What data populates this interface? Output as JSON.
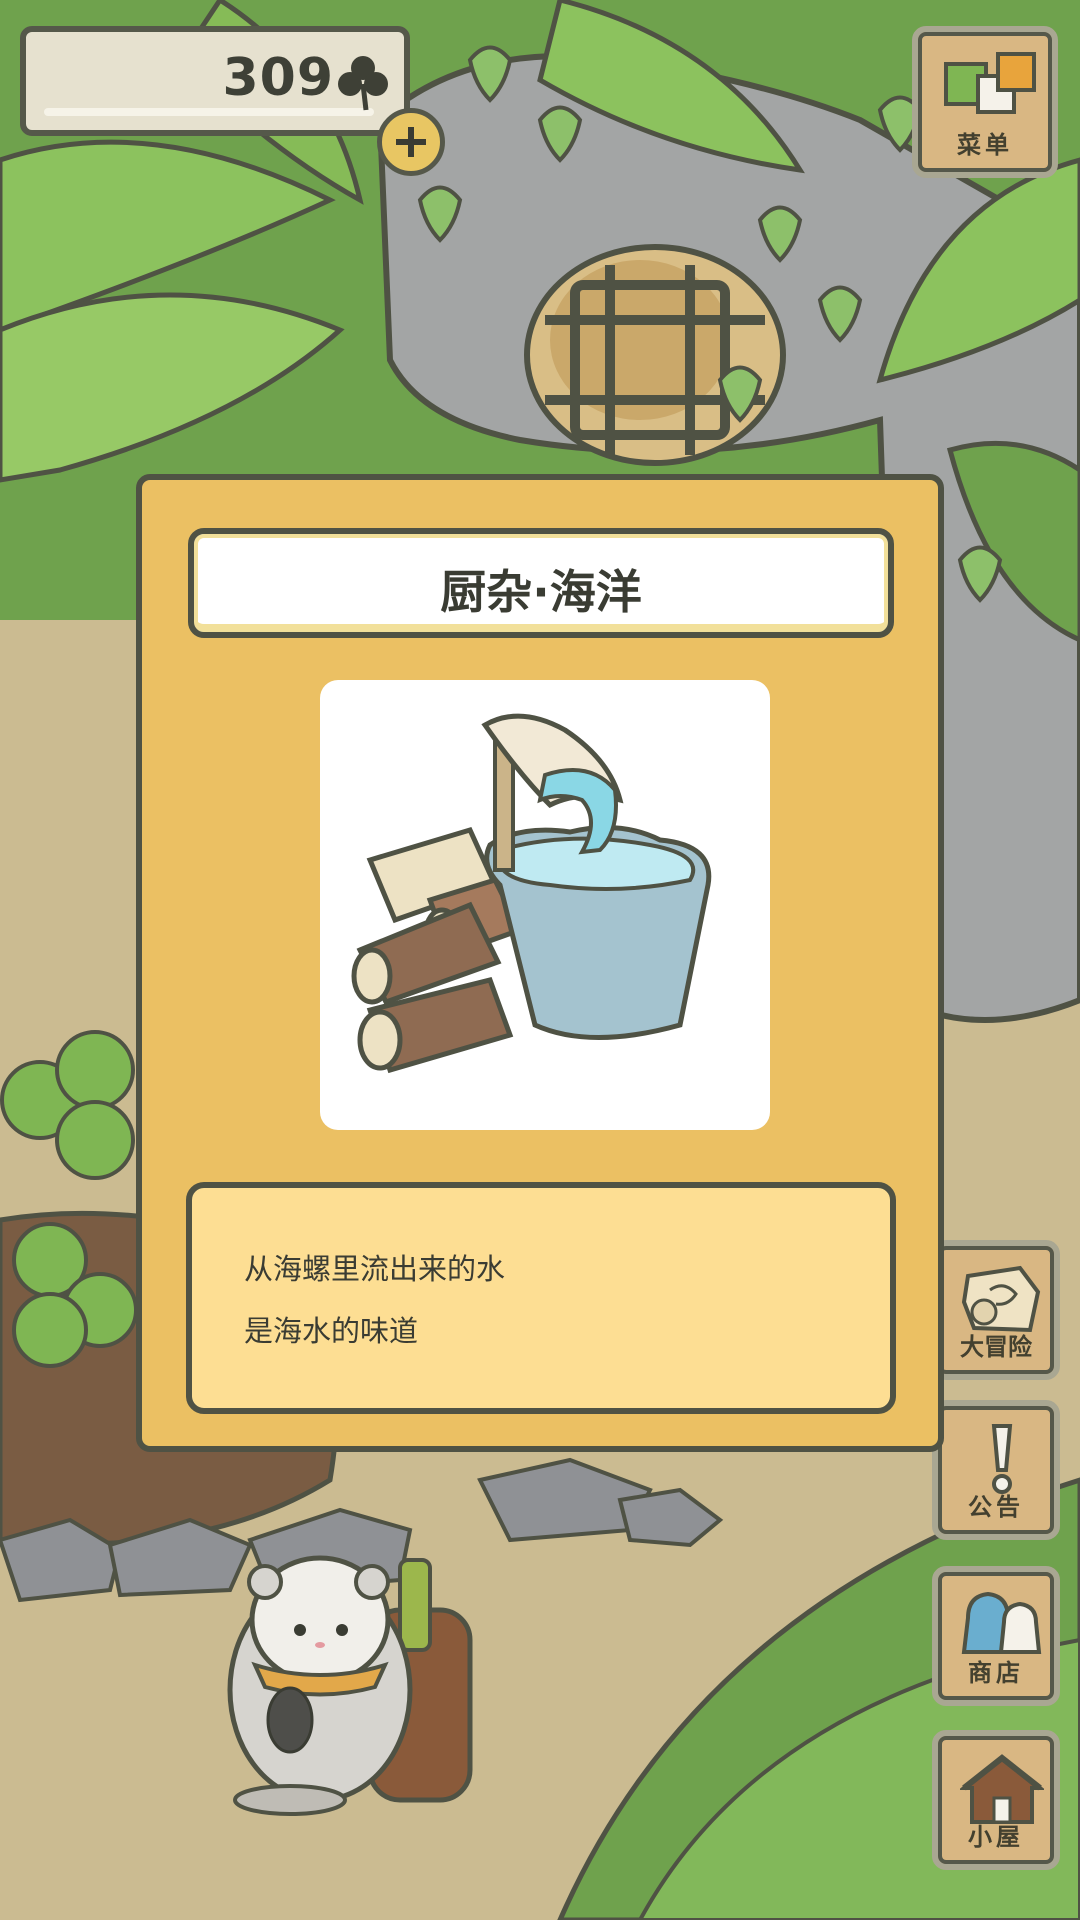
{
  "hud": {
    "clover_count": "309",
    "clover_icon": "clover-icon",
    "add_icon": "plus-icon"
  },
  "menu_button": {
    "label": "菜单",
    "icon": "menu-squares-icon"
  },
  "side_buttons": [
    {
      "label": "大冒险",
      "icon": "map-scroll-icon"
    },
    {
      "label": "公告",
      "icon": "exclamation-icon"
    },
    {
      "label": "商店",
      "icon": "shop-bags-icon"
    },
    {
      "label": "小屋",
      "icon": "house-icon"
    }
  ],
  "item_modal": {
    "title": "厨杂·海洋",
    "image": "seashell-water-bucket-and-firewood",
    "description_lines": [
      "从海螺里流出来的水",
      "是海水的味道"
    ]
  },
  "colors": {
    "modal_bg": "#ebc063",
    "desc_bg": "#fdde93",
    "outline": "#4f5244",
    "wood": "#d9b783",
    "leaf": "#7fb653"
  }
}
